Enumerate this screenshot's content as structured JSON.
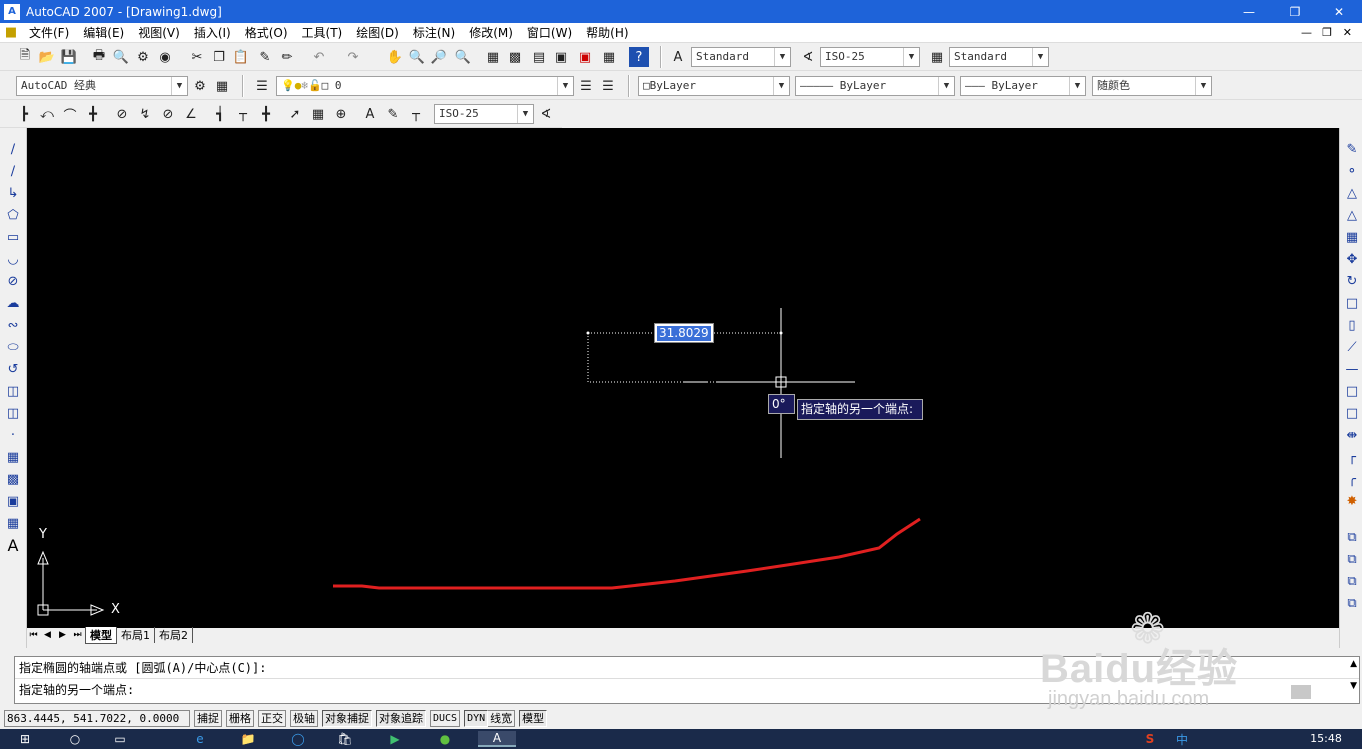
{
  "window": {
    "title": "AutoCAD 2007 - [Drawing1.dwg]",
    "app_icon": "autocad-icon",
    "controls": [
      "minimize",
      "restore",
      "close"
    ]
  },
  "menu": {
    "items": [
      "文件(F)",
      "编辑(E)",
      "视图(V)",
      "插入(I)",
      "格式(O)",
      "工具(T)",
      "绘图(D)",
      "标注(N)",
      "修改(M)",
      "窗口(W)",
      "帮助(H)"
    ]
  },
  "toolbar_standard": {
    "text_style": "Standard",
    "dim_style": "ISO-25",
    "table_style": "Standard"
  },
  "toolbar_layers": {
    "workspace": "AutoCAD 经典",
    "layer": "0",
    "color": "ByLayer",
    "linetype": "ByLayer",
    "lineweight": "ByLayer",
    "plot_style": "随颜色"
  },
  "toolbar_dim": {
    "dim_style": "ISO-25"
  },
  "canvas": {
    "dynamic_input_value": "31.8029",
    "angle_value": "0°",
    "tooltip": "指定轴的另一个端点:",
    "ucs_x": "X",
    "ucs_y": "Y",
    "curve_color": "#e02020"
  },
  "tabs": {
    "model": "模型",
    "layout1": "布局1",
    "layout2": "布局2"
  },
  "command": {
    "line1": "指定椭圆的轴端点或 [圆弧(A)/中心点(C)]:",
    "line2": "指定轴的另一个端点:"
  },
  "status": {
    "coords": "863.4445, 541.7022, 0.0000",
    "buttons": [
      "捕捉",
      "栅格",
      "正交",
      "极轴",
      "对象捕捉",
      "对象追踪",
      "DUCS",
      "DYN",
      "线宽",
      "模型"
    ]
  },
  "taskbar": {
    "time": "15:48",
    "ime": "中"
  },
  "watermark": {
    "brand": "Baidu经验",
    "url": "jingyan.baidu.com"
  }
}
